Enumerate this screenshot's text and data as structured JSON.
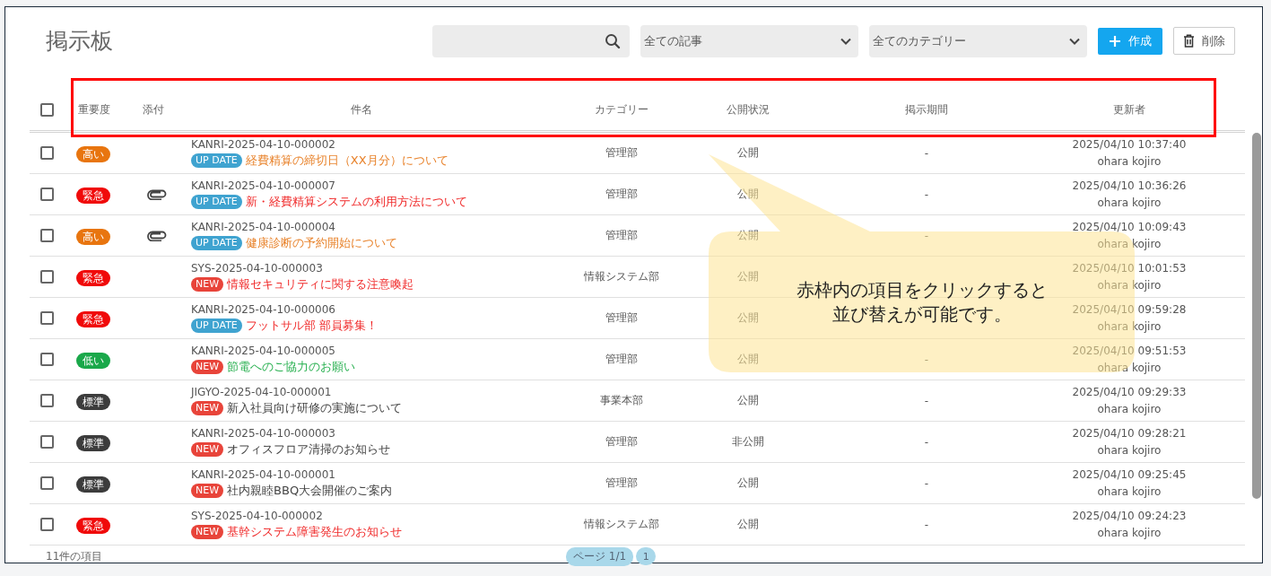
{
  "page": {
    "title": "掲示板"
  },
  "toolbar": {
    "filters": [
      {
        "value": "全ての記事"
      },
      {
        "value": "全てのカテゴリー"
      }
    ],
    "create_button": "作成",
    "delete_button": "削除"
  },
  "table": {
    "select_all": {
      "checked": false
    },
    "columns": [
      "重要度",
      "添付",
      "件名",
      "カテゴリー",
      "公開状況",
      "掲示期間",
      "更新者"
    ],
    "rows": [
      {
        "checked": false,
        "priority": {
          "label": "高い",
          "kind": "high"
        },
        "attachment": false,
        "id": "KANRI-2025-04-10-000002",
        "tag": {
          "label": "UP DATE",
          "kind": "update"
        },
        "title": "経費精算の締切日（XX月分）について",
        "category": "管理部",
        "status": "公開",
        "period": "-",
        "updated": "2025/04/10 10:37:40",
        "user": "ohara kojiro"
      },
      {
        "checked": false,
        "priority": {
          "label": "緊急",
          "kind": "urgent"
        },
        "attachment": true,
        "id": "KANRI-2025-04-10-000007",
        "tag": {
          "label": "UP DATE",
          "kind": "update"
        },
        "title": "新・経費精算システムの利用方法について",
        "category": "管理部",
        "status": "公開",
        "period": "-",
        "updated": "2025/04/10 10:36:26",
        "user": "ohara kojiro"
      },
      {
        "checked": false,
        "priority": {
          "label": "高い",
          "kind": "high"
        },
        "attachment": true,
        "id": "KANRI-2025-04-10-000004",
        "tag": {
          "label": "UP DATE",
          "kind": "update"
        },
        "title": "健康診断の予約開始について",
        "category": "管理部",
        "status": "公開",
        "period": "-",
        "updated": "2025/04/10 10:09:43",
        "user": "ohara kojiro"
      },
      {
        "checked": false,
        "priority": {
          "label": "緊急",
          "kind": "urgent"
        },
        "attachment": false,
        "id": "SYS-2025-04-10-000003",
        "tag": {
          "label": "NEW",
          "kind": "new"
        },
        "title": "情報セキュリティに関する注意喚起",
        "category": "情報システム部",
        "status": "公開",
        "updated": "2025/04/10 10:01:53",
        "user": "ohara kojiro"
      },
      {
        "checked": false,
        "priority": {
          "label": "緊急",
          "kind": "urgent"
        },
        "attachment": false,
        "id": "KANRI-2025-04-10-000006",
        "tag": {
          "label": "UP DATE",
          "kind": "update"
        },
        "title": "フットサル部 部員募集！",
        "category": "管理部",
        "status": "公開",
        "updated": "2025/04/10 09:59:28",
        "user": "ohara kojiro"
      },
      {
        "checked": false,
        "priority": {
          "label": "低い",
          "kind": "low"
        },
        "attachment": false,
        "id": "KANRI-2025-04-10-000005",
        "tag": {
          "label": "NEW",
          "kind": "new"
        },
        "title": "節電へのご協力のお願い",
        "category": "管理部",
        "status": "公開",
        "period": "-",
        "updated": "2025/04/10 09:51:53",
        "user": "ohara kojiro"
      },
      {
        "checked": false,
        "priority": {
          "label": "標準",
          "kind": "normal"
        },
        "attachment": false,
        "id": "JIGYO-2025-04-10-000001",
        "tag": {
          "label": "NEW",
          "kind": "new"
        },
        "title": "新入社員向け研修の実施について",
        "category": "事業本部",
        "status": "公開",
        "period": "-",
        "updated": "2025/04/10 09:29:33",
        "user": "ohara kojiro"
      },
      {
        "checked": false,
        "priority": {
          "label": "標準",
          "kind": "normal"
        },
        "attachment": false,
        "id": "KANRI-2025-04-10-000003",
        "tag": {
          "label": "NEW",
          "kind": "new"
        },
        "title": "オフィスフロア清掃のお知らせ",
        "category": "管理部",
        "status": "非公開",
        "period": "-",
        "updated": "2025/04/10 09:28:21",
        "user": "ohara kojiro"
      },
      {
        "checked": false,
        "priority": {
          "label": "標準",
          "kind": "normal"
        },
        "attachment": false,
        "id": "KANRI-2025-04-10-000001",
        "tag": {
          "label": "NEW",
          "kind": "new"
        },
        "title": "社内親睦BBQ大会開催のご案内",
        "category": "管理部",
        "status": "公開",
        "period": "-",
        "updated": "2025/04/10 09:25:45",
        "user": "ohara kojiro"
      },
      {
        "checked": false,
        "priority": {
          "label": "緊急",
          "kind": "urgent"
        },
        "attachment": false,
        "id": "SYS-2025-04-10-000002",
        "tag": {
          "label": "NEW",
          "kind": "new"
        },
        "title": "基幹システム障害発生のお知らせ",
        "category": "情報システム部",
        "status": "公開",
        "period": "-",
        "updated": "2025/04/10 09:24:23",
        "user": "ohara kojiro"
      }
    ]
  },
  "footer": {
    "count": "11件の項目",
    "page_info": "ページ 1/1",
    "pages": [
      {
        "label": "1",
        "selected": true
      }
    ]
  },
  "callout": {
    "lines": [
      "赤枠内の項目をクリックすると",
      "並び替えが可能です。"
    ]
  }
}
